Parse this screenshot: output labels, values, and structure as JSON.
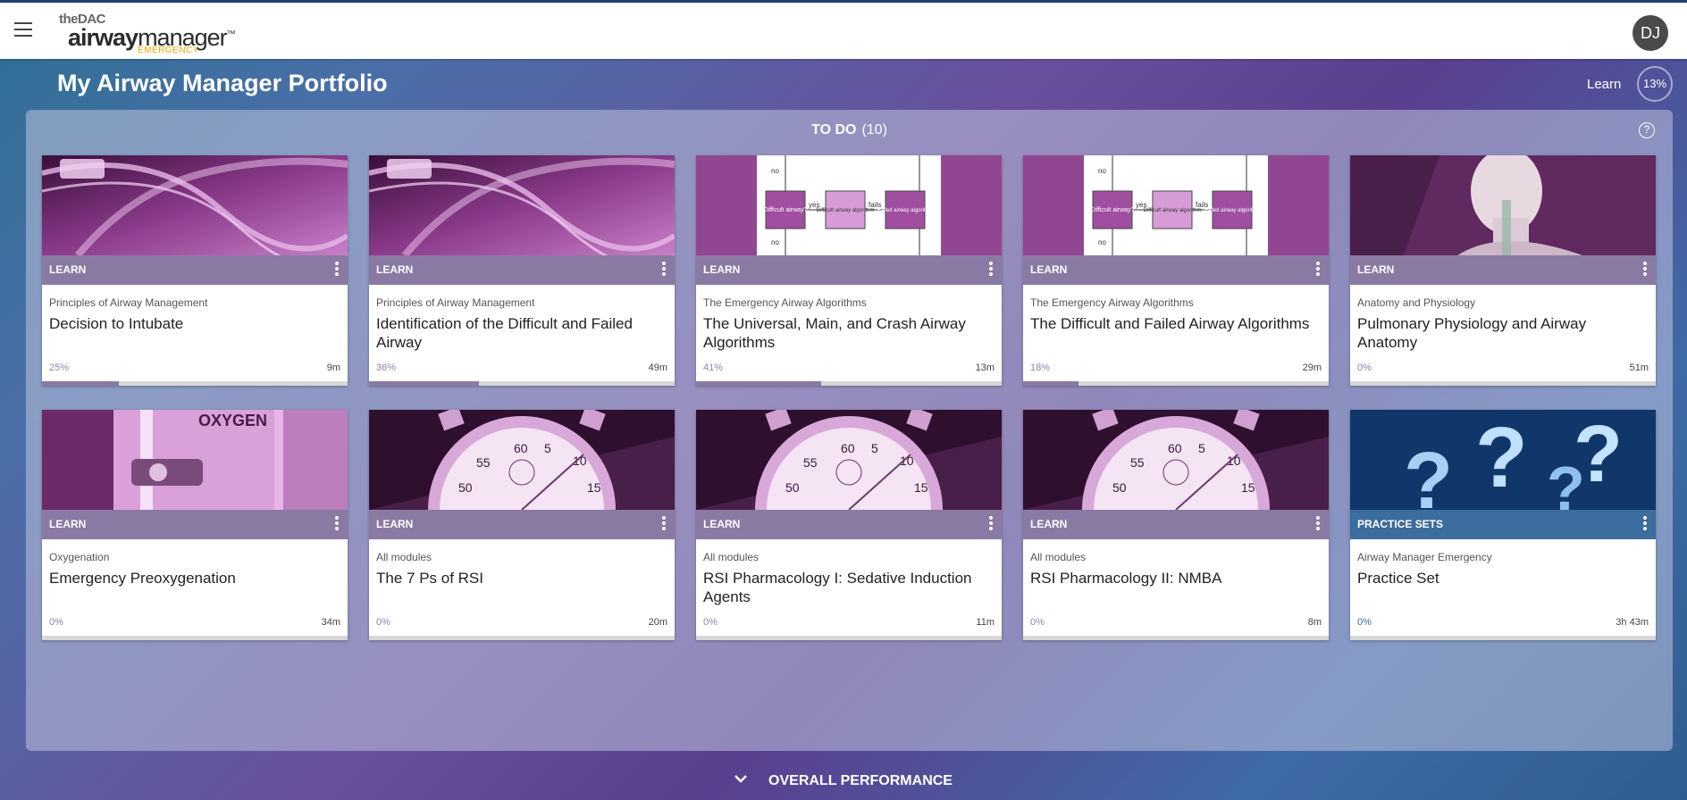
{
  "header": {
    "logo_the_dac": "theDAC",
    "logo_airway_bold": "airway",
    "logo_airway_rest": "manager",
    "logo_tm": "™",
    "logo_emergency": "EMERGENCY",
    "avatar_initials": "DJ"
  },
  "page": {
    "title": "My Airway Manager Portfolio",
    "learn_label": "Learn",
    "learn_progress": "13%"
  },
  "todo": {
    "label": "TO DO",
    "count": "(10)",
    "help_icon": "?"
  },
  "cards": [
    {
      "band": "LEARN",
      "category": "Principles of Airway Management",
      "title": "Decision to Intubate",
      "percent": "25%",
      "progress": 0.25,
      "duration": "9m",
      "image": "tube"
    },
    {
      "band": "LEARN",
      "category": "Principles of Airway Management",
      "title": "Identification of the Difficult and Failed Airway",
      "percent": "36%",
      "progress": 0.36,
      "duration": "49m",
      "image": "tube"
    },
    {
      "band": "LEARN",
      "category": "The Emergency Airway Algorithms",
      "title": "The Universal, Main, and Crash Airway Algorithms",
      "percent": "41%",
      "progress": 0.41,
      "duration": "13m",
      "image": "flowchart"
    },
    {
      "band": "LEARN",
      "category": "The Emergency Airway Algorithms",
      "title": "The Difficult and Failed Airway Algorithms",
      "percent": "18%",
      "progress": 0.18,
      "duration": "29m",
      "image": "flowchart"
    },
    {
      "band": "LEARN",
      "category": "Anatomy and Physiology",
      "title": "Pulmonary Physiology and Airway Anatomy",
      "percent": "0%",
      "progress": 0,
      "duration": "51m",
      "image": "anatomy"
    },
    {
      "band": "LEARN",
      "category": "Oxygenation",
      "title": "Emergency Preoxygenation",
      "percent": "0%",
      "progress": 0,
      "duration": "34m",
      "image": "oxygen"
    },
    {
      "band": "LEARN",
      "category": "All modules",
      "title": "The 7 Ps of RSI",
      "percent": "0%",
      "progress": 0,
      "duration": "20m",
      "image": "stopwatch"
    },
    {
      "band": "LEARN",
      "category": "All modules",
      "title": "RSI Pharmacology I: Sedative Induction Agents",
      "percent": "0%",
      "progress": 0,
      "duration": "11m",
      "image": "stopwatch"
    },
    {
      "band": "LEARN",
      "category": "All modules",
      "title": "RSI Pharmacology II: NMBA",
      "percent": "0%",
      "progress": 0,
      "duration": "8m",
      "image": "stopwatch"
    },
    {
      "band": "PRACTICE SETS",
      "category": "Airway Manager Emergency",
      "title": "Practice Set",
      "percent": "0%",
      "progress": 0,
      "duration": "3h 43m",
      "image": "questions"
    }
  ],
  "flowchart_labels": {
    "no": "no",
    "yes": "yes",
    "fails": "fails",
    "box1": "Difficult airway?",
    "box2": "Difficult airway algorithm",
    "box3": "Failed airway algorithm"
  },
  "image_text": {
    "oxygen": "OXYGEN",
    "watch_60": "60",
    "watch_5": "5",
    "watch_10": "10",
    "watch_55": "55",
    "watch_50": "50",
    "watch_15": "15"
  },
  "footer": {
    "overall_performance": "OVERALL PERFORMANCE"
  },
  "colors": {
    "band_learn": "#8a7aa3",
    "band_practice": "#3d6c9e",
    "topbar_border": "#1f3f6e"
  }
}
